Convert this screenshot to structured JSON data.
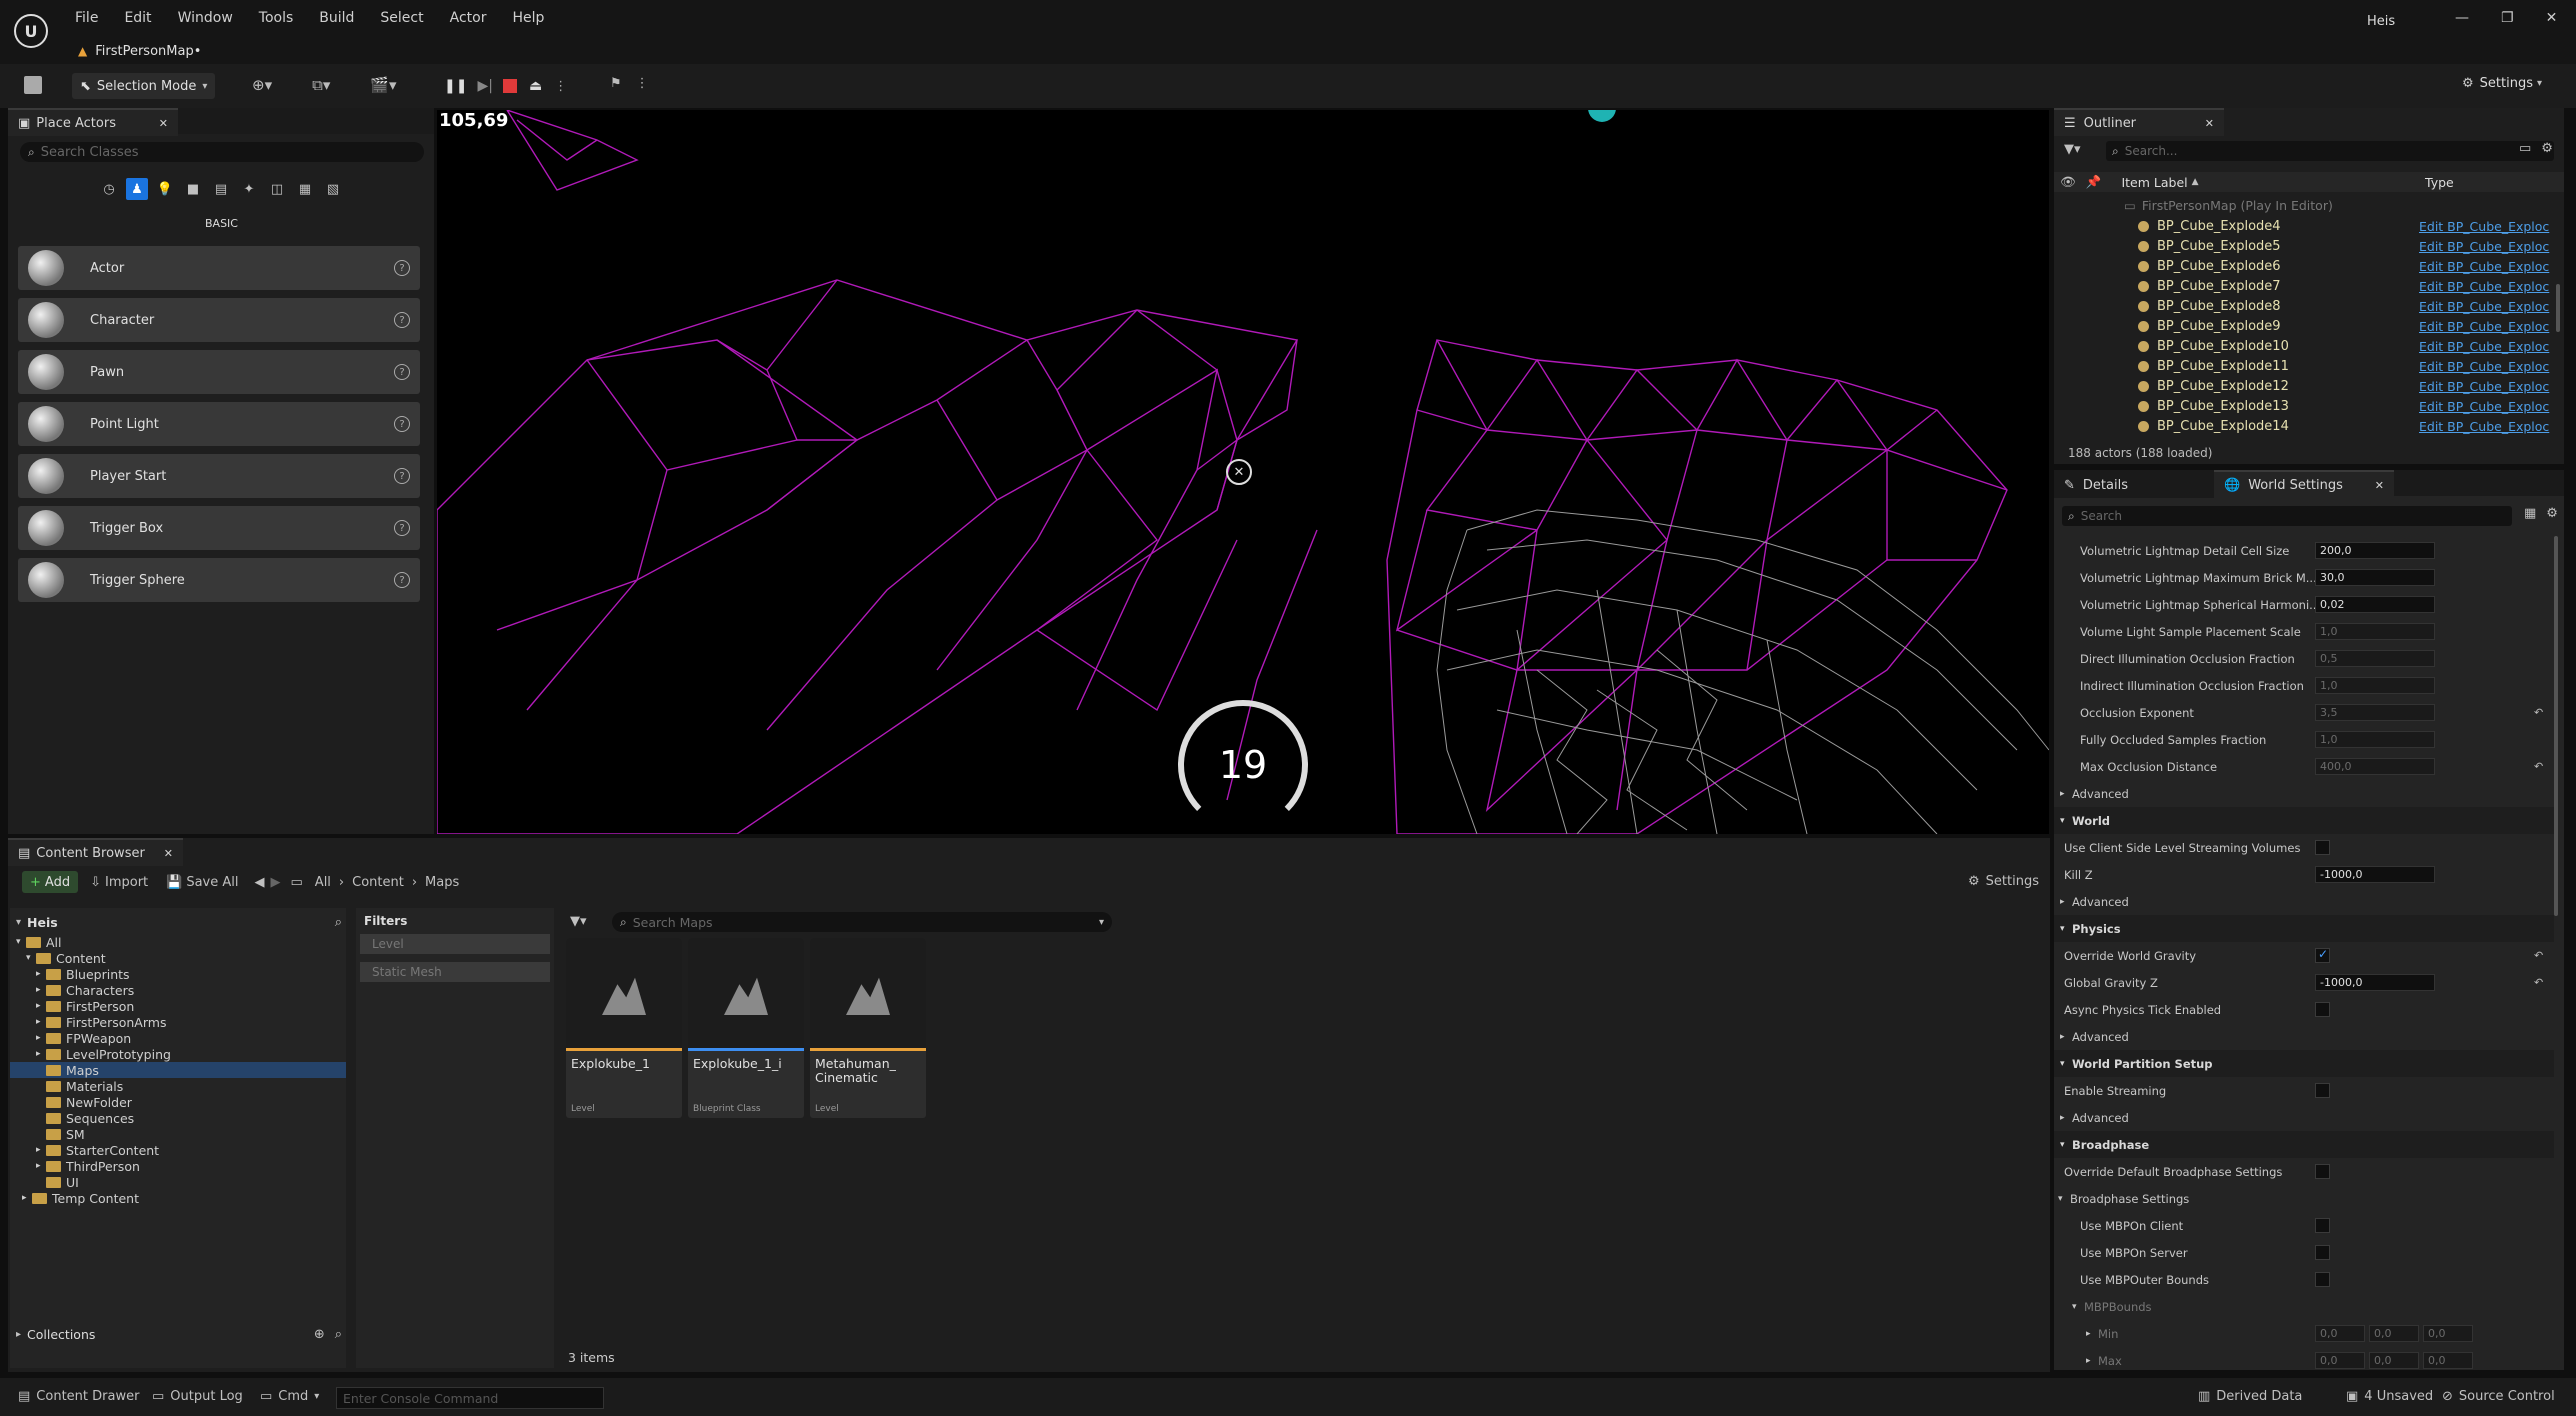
{
  "app": {
    "title": "FirstPersonMap•",
    "user": "Heis"
  },
  "menu": [
    "File",
    "Edit",
    "Window",
    "Tools",
    "Build",
    "Select",
    "Actor",
    "Help"
  ],
  "toolbar": {
    "mode": "Selection Mode",
    "settings": "Settings"
  },
  "viewport": {
    "fps": "105,69",
    "counter": "19"
  },
  "place_actors": {
    "title": "Place Actors",
    "search_placeholder": "Search Classes",
    "category": "BASIC",
    "items": [
      "Actor",
      "Character",
      "Pawn",
      "Point Light",
      "Player Start",
      "Trigger Box",
      "Trigger Sphere"
    ]
  },
  "outliner": {
    "title": "Outliner",
    "search_placeholder": "Search...",
    "col_label": "Item Label",
    "col_type": "Type",
    "root": "FirstPersonMap (Play In Editor)",
    "rows": [
      {
        "name": "BP_Cube_Explode4",
        "type": "Edit BP_Cube_Exploc"
      },
      {
        "name": "BP_Cube_Explode5",
        "type": "Edit BP_Cube_Exploc"
      },
      {
        "name": "BP_Cube_Explode6",
        "type": "Edit BP_Cube_Exploc"
      },
      {
        "name": "BP_Cube_Explode7",
        "type": "Edit BP_Cube_Exploc"
      },
      {
        "name": "BP_Cube_Explode8",
        "type": "Edit BP_Cube_Exploc"
      },
      {
        "name": "BP_Cube_Explode9",
        "type": "Edit BP_Cube_Exploc"
      },
      {
        "name": "BP_Cube_Explode10",
        "type": "Edit BP_Cube_Exploc"
      },
      {
        "name": "BP_Cube_Explode11",
        "type": "Edit BP_Cube_Exploc"
      },
      {
        "name": "BP_Cube_Explode12",
        "type": "Edit BP_Cube_Exploc"
      },
      {
        "name": "BP_Cube_Explode13",
        "type": "Edit BP_Cube_Exploc"
      },
      {
        "name": "BP_Cube_Explode14",
        "type": "Edit BP_Cube_Exploc"
      }
    ],
    "footer": "188 actors (188 loaded)"
  },
  "details": {
    "tab_details": "Details",
    "tab_world": "World Settings",
    "search_placeholder": "Search",
    "rows": [
      {
        "kind": "prop",
        "indent": 2,
        "label": "Volumetric Lightmap Detail Cell Size",
        "value": "200,0"
      },
      {
        "kind": "prop",
        "indent": 2,
        "label": "Volumetric Lightmap Maximum Brick M...",
        "value": "30,0"
      },
      {
        "kind": "prop",
        "indent": 2,
        "label": "Volumetric Lightmap Spherical Harmoni...",
        "value": "0,02"
      },
      {
        "kind": "prop",
        "indent": 2,
        "label": "Volume Light Sample Placement Scale",
        "value": "1,0",
        "dim": true
      },
      {
        "kind": "prop",
        "indent": 2,
        "label": "Direct Illumination Occlusion Fraction",
        "value": "0,5",
        "dim": true
      },
      {
        "kind": "prop",
        "indent": 2,
        "label": "Indirect Illumination Occlusion Fraction",
        "value": "1,0",
        "dim": true
      },
      {
        "kind": "prop",
        "indent": 2,
        "label": "Occlusion Exponent",
        "value": "3,5",
        "dim": true,
        "reset": true
      },
      {
        "kind": "prop",
        "indent": 2,
        "label": "Fully Occluded Samples Fraction",
        "value": "1,0",
        "dim": true
      },
      {
        "kind": "prop",
        "indent": 2,
        "label": "Max Occlusion Distance",
        "value": "400,0",
        "dim": true,
        "reset": true
      },
      {
        "kind": "adv",
        "label": "Advanced"
      },
      {
        "kind": "cat",
        "label": "World"
      },
      {
        "kind": "check",
        "indent": 1,
        "label": "Use Client Side Level Streaming Volumes",
        "checked": false
      },
      {
        "kind": "prop",
        "indent": 1,
        "label": "Kill Z",
        "value": "-1000,0"
      },
      {
        "kind": "adv",
        "label": "Advanced"
      },
      {
        "kind": "cat",
        "label": "Physics"
      },
      {
        "kind": "check",
        "indent": 1,
        "label": "Override World Gravity",
        "checked": true,
        "reset": true
      },
      {
        "kind": "prop",
        "indent": 1,
        "label": "Global Gravity Z",
        "value": "-1000,0",
        "reset": true
      },
      {
        "kind": "check",
        "indent": 1,
        "label": "Async Physics Tick Enabled",
        "checked": false
      },
      {
        "kind": "adv",
        "label": "Advanced"
      },
      {
        "kind": "cat",
        "label": "World Partition Setup"
      },
      {
        "kind": "check",
        "indent": 1,
        "label": "Enable Streaming",
        "checked": false
      },
      {
        "kind": "adv",
        "label": "Advanced"
      },
      {
        "kind": "cat",
        "label": "Broadphase"
      },
      {
        "kind": "check",
        "indent": 1,
        "label": "Override Default Broadphase Settings",
        "checked": false
      },
      {
        "kind": "sub",
        "label": "Broadphase Settings"
      },
      {
        "kind": "check",
        "indent": 2,
        "label": "Use MBPOn Client",
        "checked": false
      },
      {
        "kind": "check",
        "indent": 2,
        "label": "Use MBPOn Server",
        "checked": false
      },
      {
        "kind": "check",
        "indent": 2,
        "label": "Use MBPOuter Bounds",
        "checked": false
      },
      {
        "kind": "sub2",
        "label": "MBPBounds"
      },
      {
        "kind": "vec",
        "label": "Min",
        "values": [
          "0,0",
          "0,0",
          "0,0"
        ]
      },
      {
        "kind": "vec",
        "label": "Max",
        "values": [
          "0,0",
          "0,0",
          "0,0"
        ]
      }
    ]
  },
  "content_browser": {
    "title": "Content Browser",
    "add": "Add",
    "import": "Import",
    "save_all": "Save All",
    "breadcrumb": [
      "All",
      "Content",
      "Maps"
    ],
    "settings": "Settings",
    "root_label": "Heis",
    "filters_title": "Filters",
    "filters": [
      "Level",
      "Static Mesh"
    ],
    "search_placeholder": "Search Maps",
    "tree": [
      {
        "label": "All",
        "depth": 0,
        "expand": "▾"
      },
      {
        "label": "Content",
        "depth": 1,
        "expand": "▾"
      },
      {
        "label": "Blueprints",
        "depth": 2,
        "expand": "▸"
      },
      {
        "label": "Characters",
        "depth": 2,
        "expand": "▸"
      },
      {
        "label": "FirstPerson",
        "depth": 2,
        "expand": "▸"
      },
      {
        "label": "FirstPersonArms",
        "depth": 2,
        "expand": "▸"
      },
      {
        "label": "FPWeapon",
        "depth": 2,
        "expand": "▸"
      },
      {
        "label": "LevelPrototyping",
        "depth": 2,
        "expand": "▸"
      },
      {
        "label": "Maps",
        "depth": 2,
        "expand": "",
        "selected": true
      },
      {
        "label": "Materials",
        "depth": 2,
        "expand": ""
      },
      {
        "label": "NewFolder",
        "depth": 2,
        "expand": ""
      },
      {
        "label": "Sequences",
        "depth": 2,
        "expand": ""
      },
      {
        "label": "SM",
        "depth": 2,
        "expand": ""
      },
      {
        "label": "StarterContent",
        "depth": 2,
        "expand": "▸"
      },
      {
        "label": "ThirdPerson",
        "depth": 2,
        "expand": "▸"
      },
      {
        "label": "UI",
        "depth": 2,
        "expand": ""
      },
      {
        "label": "Temp Content",
        "depth": 0,
        "expand": "▸"
      }
    ],
    "assets": [
      {
        "name": "Explokube_1",
        "type": "Level",
        "color": "#e8a13a"
      },
      {
        "name": "Explokube_1_i",
        "type": "Blueprint Class",
        "color": "#3d8ef0"
      },
      {
        "name": "Metahuman_ Cinematic",
        "type": "Level",
        "color": "#e8a13a"
      }
    ],
    "item_count": "3 items",
    "collections": "Collections"
  },
  "statusbar": {
    "content_drawer": "Content Drawer",
    "output_log": "Output Log",
    "cmd": "Cmd",
    "console_placeholder": "Enter Console Command",
    "derived_data": "Derived Data",
    "unsaved": "4 Unsaved",
    "source_control": "Source Control"
  },
  "colors": {
    "accent": "#3d8ef0",
    "wire_magenta": "#b01ab8",
    "folder": "#c8a047"
  }
}
